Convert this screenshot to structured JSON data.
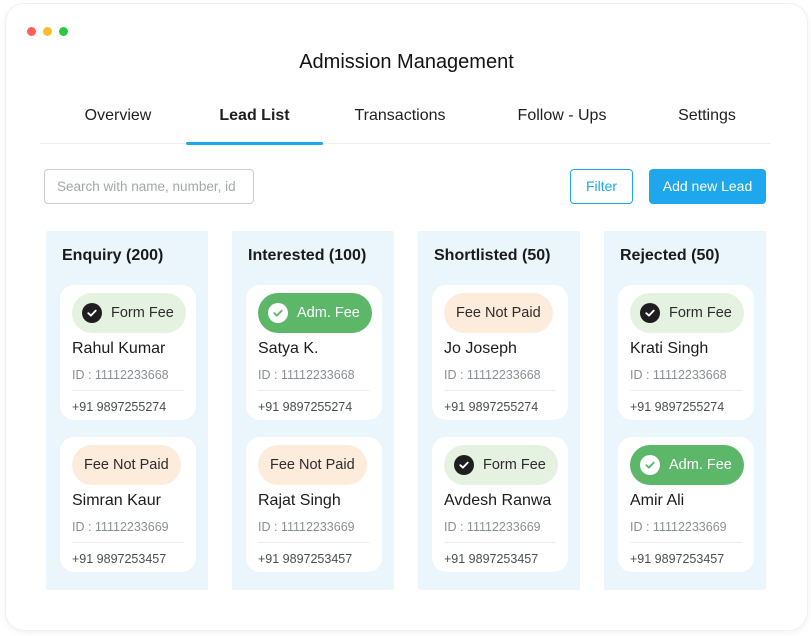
{
  "window": {
    "dots": [
      "#ff5f57",
      "#febc2e",
      "#28c840"
    ]
  },
  "app": {
    "title": "Admission Management"
  },
  "tabs": [
    {
      "label": "Overview"
    },
    {
      "label": "Lead List",
      "active": true
    },
    {
      "label": "Transactions"
    },
    {
      "label": "Follow - Ups"
    },
    {
      "label": "Settings"
    }
  ],
  "toolbar": {
    "search_placeholder": "Search with name, number, id",
    "filter_label": "Filter",
    "add_label": "Add new Lead"
  },
  "colors": {
    "accent": "#1ea7ec",
    "column_bg": "#eaf6fb",
    "form_fee_badge": "#e5f2e2",
    "adm_fee_badge": "#5cb768",
    "fee_not_paid_badge": "#fdecdc"
  },
  "columns": [
    {
      "title": "Enquiry (200)",
      "cards": [
        {
          "badge": "Form Fee",
          "badge_type": "form",
          "icon": "check-circle-icon",
          "name": "Rahul Kumar",
          "id": "ID : 11112233668",
          "phone": "+91 9897255274"
        },
        {
          "badge": "Fee Not Paid",
          "badge_type": "fee",
          "icon": "",
          "name": "Simran Kaur",
          "id": "ID : 11112233669",
          "phone": "+91 9897253457"
        }
      ]
    },
    {
      "title": "Interested (100)",
      "cards": [
        {
          "badge": "Adm. Fee",
          "badge_type": "adm",
          "icon": "check-circle-icon",
          "name": "Satya K.",
          "id": "ID : 11112233668",
          "phone": "+91 9897255274"
        },
        {
          "badge": "Fee Not Paid",
          "badge_type": "fee",
          "icon": "",
          "name": "Rajat Singh",
          "id": "ID : 11112233669",
          "phone": "+91 9897253457"
        }
      ]
    },
    {
      "title": "Shortlisted (50)",
      "cards": [
        {
          "badge": "Fee Not Paid",
          "badge_type": "fee",
          "icon": "",
          "name": "Jo Joseph",
          "id": "ID : 11112233668",
          "phone": "+91 9897255274"
        },
        {
          "badge": "Form Fee",
          "badge_type": "form",
          "icon": "check-circle-icon",
          "name": "Avdesh Ranwa",
          "id": "ID : 11112233669",
          "phone": "+91 9897253457"
        }
      ]
    },
    {
      "title": "Rejected (50)",
      "cards": [
        {
          "badge": "Form Fee",
          "badge_type": "form",
          "icon": "check-circle-icon",
          "name": "Krati Singh",
          "id": "ID : 11112233668",
          "phone": "+91 9897255274"
        },
        {
          "badge": "Adm. Fee",
          "badge_type": "adm",
          "icon": "check-circle-icon",
          "name": "Amir Ali",
          "id": "ID : 11112233669",
          "phone": "+91 9897253457"
        }
      ]
    }
  ]
}
